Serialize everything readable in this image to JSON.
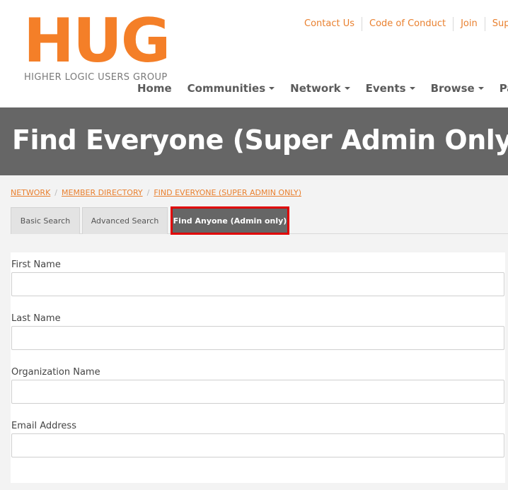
{
  "logo": {
    "mark": "HUG",
    "subtitle": "HIGHER LOGIC USERS GROUP"
  },
  "utility_nav": [
    "Contact Us",
    "Code of Conduct",
    "Join",
    "Suppor"
  ],
  "main_nav": [
    {
      "label": "Home",
      "dropdown": false
    },
    {
      "label": "Communities",
      "dropdown": true
    },
    {
      "label": "Network",
      "dropdown": true
    },
    {
      "label": "Events",
      "dropdown": true
    },
    {
      "label": "Browse",
      "dropdown": true
    },
    {
      "label": "Partici",
      "dropdown": false
    }
  ],
  "page_title": "Find Everyone (Super Admin Only)",
  "breadcrumb": [
    "NETWORK",
    "MEMBER DIRECTORY",
    "FIND EVERYONE (SUPER ADMIN ONLY)"
  ],
  "tabs": [
    "Basic Search",
    "Advanced Search",
    "Find Anyone (Admin only)"
  ],
  "form": {
    "fields": [
      {
        "label": "First Name",
        "value": ""
      },
      {
        "label": "Last Name",
        "value": ""
      },
      {
        "label": "Organization Name",
        "value": ""
      },
      {
        "label": "Email Address",
        "value": ""
      }
    ]
  },
  "colors": {
    "accent": "#f47f28",
    "banner": "#666666",
    "highlight": "#e00000"
  }
}
